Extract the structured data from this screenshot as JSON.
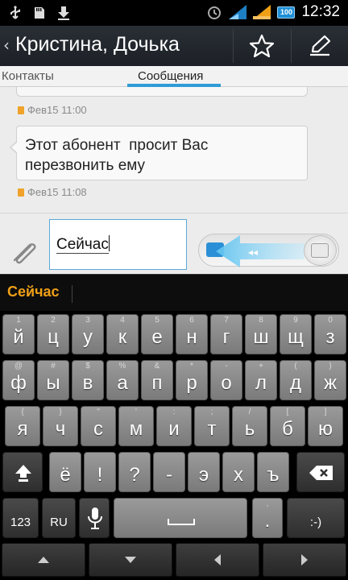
{
  "status_bar": {
    "time": "12:32",
    "battery": "100",
    "icons": [
      "usb-icon",
      "sd-card-icon",
      "download-icon",
      "alarm-icon",
      "signal-icon",
      "signal-icon",
      "battery-icon"
    ]
  },
  "action_bar": {
    "title": "Кристина, Дочька",
    "icons": [
      "back-caret-icon",
      "star-icon",
      "compose-icon"
    ]
  },
  "tabs": [
    {
      "label": "Контакты",
      "selected": false
    },
    {
      "label": "Сообщения",
      "selected": true
    }
  ],
  "conversation": {
    "messages": [
      {
        "timestamp": "Фев15 11:00"
      },
      {
        "text_line1": "Этот абонент  просит Вас",
        "text_line2": "перезвонить ему",
        "timestamp": "Фев15 11:08"
      }
    ]
  },
  "compose": {
    "input_value": "Сейчас"
  },
  "suggestions": {
    "word": "Сейчас"
  },
  "keyboard": {
    "row1": [
      {
        "hint": "1",
        "ch": "й"
      },
      {
        "hint": "2",
        "ch": "ц"
      },
      {
        "hint": "3",
        "ch": "у"
      },
      {
        "hint": "4",
        "ch": "к"
      },
      {
        "hint": "5",
        "ch": "е"
      },
      {
        "hint": "6",
        "ch": "н"
      },
      {
        "hint": "7",
        "ch": "г"
      },
      {
        "hint": "8",
        "ch": "ш"
      },
      {
        "hint": "9",
        "ch": "щ"
      },
      {
        "hint": "0",
        "ch": "з"
      }
    ],
    "row2": [
      {
        "hint": "@",
        "ch": "ф"
      },
      {
        "hint": "#",
        "ch": "ы"
      },
      {
        "hint": "$",
        "ch": "в"
      },
      {
        "hint": "%",
        "ch": "а"
      },
      {
        "hint": "&",
        "ch": "п"
      },
      {
        "hint": "*",
        "ch": "р"
      },
      {
        "hint": "-",
        "ch": "о"
      },
      {
        "hint": "+",
        "ch": "л"
      },
      {
        "hint": "(",
        "ch": "д"
      },
      {
        "hint": ")",
        "ch": "ж"
      }
    ],
    "row3": [
      {
        "hint": "{",
        "ch": "я"
      },
      {
        "hint": "}",
        "ch": "ч"
      },
      {
        "hint": "\"",
        "ch": "с"
      },
      {
        "hint": "'",
        "ch": "м"
      },
      {
        "hint": ":",
        "ch": "и"
      },
      {
        "hint": ";",
        "ch": "т"
      },
      {
        "hint": "/",
        "ch": "ь"
      },
      {
        "hint": "[",
        "ch": "б"
      },
      {
        "hint": "]",
        "ch": "ю"
      }
    ],
    "row4": [
      {
        "hint": "",
        "ch": "ё"
      },
      {
        "hint": "",
        "ch": "!"
      },
      {
        "hint": "",
        "ch": "?"
      },
      {
        "hint": "",
        "ch": "-"
      },
      {
        "hint": "",
        "ch": "э"
      },
      {
        "hint": "",
        "ch": "х"
      },
      {
        "hint": "",
        "ch": "ъ"
      }
    ],
    "row5": {
      "num_label": "123",
      "lang_label": "RU",
      "comma_hint": ",",
      "comma": ".",
      "smiley": ":-)"
    }
  },
  "nav_bar": {
    "icons": [
      "nav-up-icon",
      "nav-down-icon",
      "nav-left-icon",
      "nav-right-icon"
    ]
  }
}
